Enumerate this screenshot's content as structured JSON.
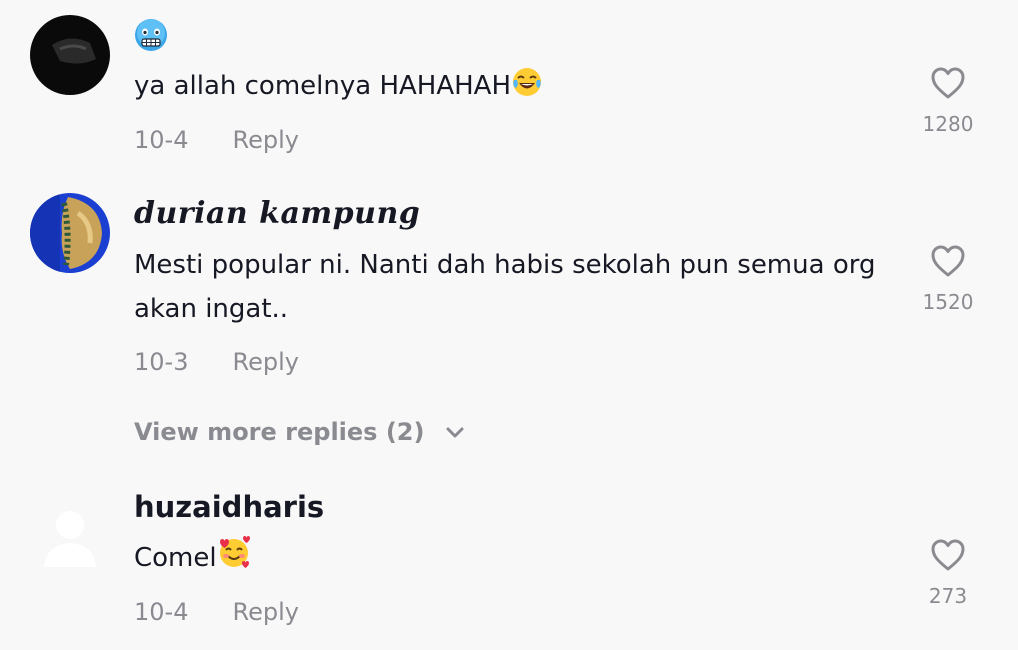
{
  "comments": [
    {
      "username": "",
      "username_emoji_icon": "cold-face-emoji-icon",
      "text": "ya allah comelnya HAHAHAH",
      "text_emoji_icon": "tears-of-joy-emoji-icon",
      "date": "10-4",
      "reply_label": "Reply",
      "likes": "1280"
    },
    {
      "username": "durian kampung",
      "text": "Mesti popular ni. Nanti dah habis sekolah pun semua org akan ingat..",
      "date": "10-3",
      "reply_label": "Reply",
      "likes": "1520",
      "view_more": "View more replies (2)"
    },
    {
      "username": "huzaidharis",
      "text": "Comel",
      "text_emoji_icon": "smiling-face-with-hearts-emoji-icon",
      "date": "10-4",
      "reply_label": "Reply",
      "likes": "273"
    }
  ],
  "colors": {
    "background": "#f8f8f8",
    "primary_text": "#161823",
    "secondary_text": "#8a8b91",
    "heart_outline": "#8a8b91"
  }
}
